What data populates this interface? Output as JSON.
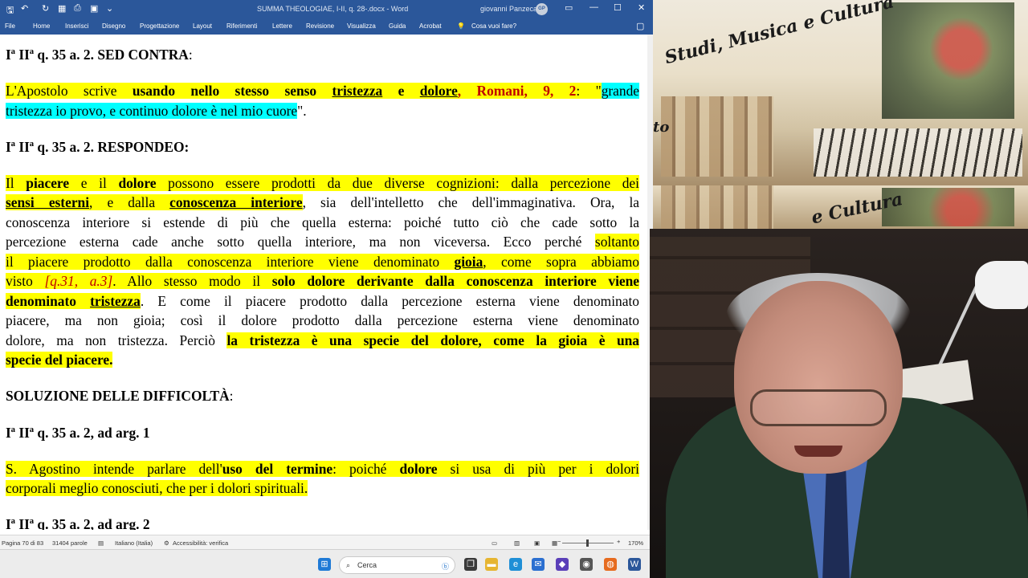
{
  "word": {
    "titlebar": {
      "file_label": "File",
      "doc_title": "SUMMA THEOLOGIAE, I-II, q. 28-.docx  -  Word",
      "user_name": "giovanni Panzeca",
      "user_initials": "GP"
    },
    "ribbon_tabs": [
      "File",
      "Home",
      "Inserisci",
      "Disegno",
      "Progettazione",
      "Layout",
      "Riferimenti",
      "Lettere",
      "Revisione",
      "Visualizza",
      "Guida",
      "Acrobat",
      "Cosa vuoi fare?"
    ],
    "document": {
      "h1": "Iª IIª q. 35 a. 2. SED CONTRA",
      "h1_colon": ":",
      "p1": {
        "a": "L'Apostolo scrive ",
        "b": "usando nello stesso senso ",
        "c": "tristezza",
        "d": " e ",
        "e": "dolore",
        "f": ", Romani, 9, 2",
        "g": ": \"",
        "h": "grande",
        "i": "tristezza io provo, e continuo dolore è nel mio cuore",
        "j": "\"."
      },
      "h2": "Iª IIª q. 35 a. 2. RESPONDEO:",
      "p2": {
        "l1_a": "Il ",
        "l1_b": "piacere",
        "l1_c": " e il ",
        "l1_d": "dolore",
        "l1_e": " possono essere prodotti da due diverse cognizioni: dalla percezione dei",
        "l2_a": "sensi esterni",
        "l2_b": ", e dalla ",
        "l2_c": "conoscenza interiore",
        "l2_d": ", sia dell'intelletto che dell'immaginativa. Ora, la",
        "l3": "conoscenza interiore si estende di più che quella esterna: poiché tutto ciò che cade sotto la",
        "l4_a": "percezione esterna cade anche sotto quella interiore, ma non viceversa. Ecco perché ",
        "l4_b": "soltanto",
        "l5_a": "il piacere prodotto dalla conoscenza interiore viene denominato ",
        "l5_b": "gioia",
        "l5_c": ", come sopra abbiamo",
        "l6_a": "visto ",
        "l6_b": "[q.31, a.3]",
        "l6_c": ". Allo stesso modo il ",
        "l6_d": "solo dolore derivante dalla conoscenza interiore viene",
        "l7_a": "denominato ",
        "l7_b": "tristezza",
        "l7_c": ". E come il piacere prodotto dalla percezione esterna viene denominato",
        "l8": "piacere, ma non gioia; così il dolore prodotto dalla percezione esterna viene denominato",
        "l9_a": "dolore, ma non tristezza. Perciò ",
        "l9_b": "la tristezza è una specie del dolore, come la gioia è una",
        "l10": "specie del piacere."
      },
      "h3": "SOLUZIONE DELLE DIFFICOLTÀ",
      "h3_colon": ":",
      "h4": "Iª IIª q. 35 a. 2, ad arg. 1",
      "p3": {
        "l1_a": "S. Agostino intende parlare dell'",
        "l1_b": "uso del termine",
        "l1_c": ": poiché ",
        "l1_d": "dolore",
        "l1_e": " si usa di più per i dolori",
        "l2": "corporali meglio conosciuti, che per i dolori spirituali."
      },
      "h5": "Iª IIª q. 35 a. 2, ad arg. 2"
    },
    "statusbar": {
      "page": "Pagina 70 di 83",
      "words": "31404 parole",
      "language": "Italiano (Italia)",
      "accessibility": "Accessibilità: verifica",
      "zoom": "170%"
    }
  },
  "banner": {
    "title": "Studi, Musica e Cultura",
    "fragment": "to",
    "title2": "e Cultura"
  },
  "taskbar": {
    "search_placeholder": "Cerca"
  }
}
